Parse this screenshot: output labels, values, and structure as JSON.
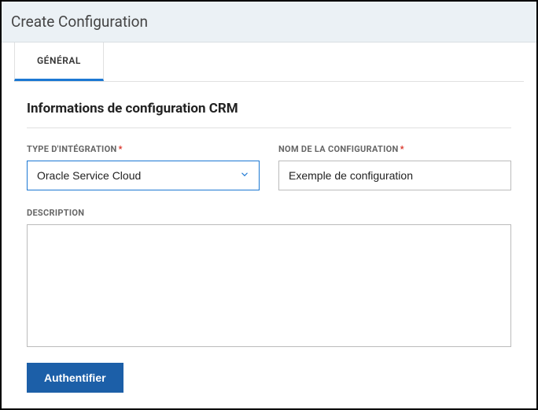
{
  "header": {
    "title": "Create Configuration"
  },
  "tabs": {
    "general": "GÉNÉRAL"
  },
  "section": {
    "title": "Informations de configuration CRM"
  },
  "fields": {
    "integrationType": {
      "label": "TYPE D'INTÉGRATION",
      "value": "Oracle Service Cloud"
    },
    "configName": {
      "label": "NOM DE LA CONFIGURATION",
      "value": "Exemple de configuration"
    },
    "description": {
      "label": "DESCRIPTION",
      "value": ""
    }
  },
  "actions": {
    "authenticate": "Authentifier"
  }
}
